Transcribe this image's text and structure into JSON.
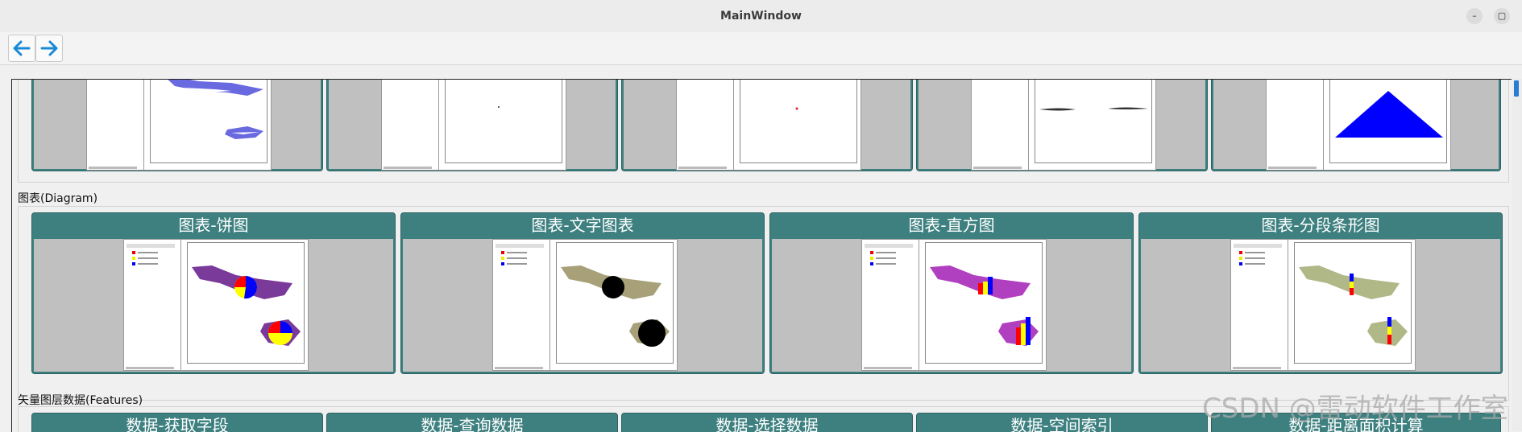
{
  "window": {
    "title": "MainWindow",
    "minimize_label": "–",
    "maximize_label": "▢"
  },
  "toolbar": {
    "back_icon": "arrow-left-icon",
    "forward_icon": "arrow-right-icon",
    "accent": "#1a8ad4"
  },
  "sections": {
    "diagram": {
      "label": "图表(Diagram)",
      "cards": [
        {
          "title": "图表-饼图"
        },
        {
          "title": "图表-文字图表"
        },
        {
          "title": "图表-直方图"
        },
        {
          "title": "图表-分段条形图"
        }
      ]
    },
    "features": {
      "label": "矢量图层数据(Features)",
      "cards": [
        {
          "title": "数据-获取字段"
        },
        {
          "title": "数据-查询数据"
        },
        {
          "title": "数据-选择数据"
        },
        {
          "title": "数据-空间索引"
        },
        {
          "title": "数据-距离面积计算"
        }
      ]
    }
  },
  "colors": {
    "card_header": "#3e8080",
    "thumbnail_bg": "#c0c0c0"
  },
  "watermark": "CSDN @雷动软件工作室"
}
